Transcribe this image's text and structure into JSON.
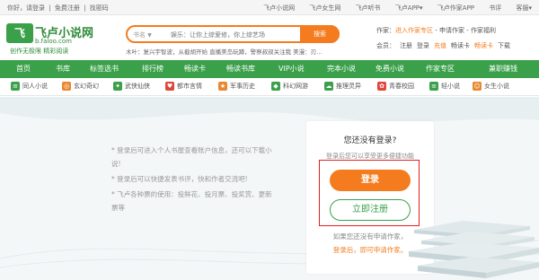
{
  "topbar": {
    "greeting": "你好，请登录",
    "free_register": "免费注册",
    "find_password": "找密码",
    "sep": "|",
    "links": [
      "飞卢小说网",
      "飞卢女生网",
      "飞卢听书",
      "飞卢APP▾",
      "飞卢作家APP",
      "书评",
      "客服▾"
    ]
  },
  "logo": {
    "mark": "飞",
    "name": "飞卢小说网",
    "domain": "b.faloo.com",
    "slogan": "创作无极限 精彩阅读"
  },
  "search": {
    "scope": "书名",
    "placeholder": "娱乐：让你上综爱修，你上综艺场",
    "button": "搜索",
    "hot_label": "木叶：",
    "hot_text": "复兴宇智波，从截胡开始  直播美岛玩蹲，警察叔叔关注我  美漫：刃..."
  },
  "author_area": {
    "label": "作家：",
    "enter": "进入作家专区",
    "sep": " - ",
    "apply": "申请作家",
    "sep2": " - ",
    "welfare": "作家福利"
  },
  "member_area": {
    "label": "会员：",
    "register": "注册",
    "login": "登录",
    "recharge": "充值",
    "coupon": "畅读卡",
    "vip_card": "畅读卡",
    "download": "下载"
  },
  "nav": [
    "首页",
    "书库",
    "标签选书",
    "排行榜",
    "畅读卡",
    "畅读书库",
    "VIP小说",
    "完本小说",
    "免费小说",
    "作家专区",
    "兼职赚钱"
  ],
  "categories": [
    {
      "label": "同人小说",
      "color": "#3aa04a"
    },
    {
      "label": "玄幻奇幻",
      "color": "#e8872f"
    },
    {
      "label": "武侠仙侠",
      "color": "#3aa04a"
    },
    {
      "label": "都市言情",
      "color": "#e0463a"
    },
    {
      "label": "军事历史",
      "color": "#e8872f"
    },
    {
      "label": "科幻网游",
      "color": "#3aa04a"
    },
    {
      "label": "推理灵异",
      "color": "#3aa04a"
    },
    {
      "label": "青春校园",
      "color": "#e0463a"
    },
    {
      "label": "轻小说",
      "color": "#3aa04a"
    },
    {
      "label": "女生小说",
      "color": "#e8872f"
    }
  ],
  "tips": [
    "* 登录后可进入个人书屋查看账户信息，还可以下载小说!",
    "* 登录后可以快捷发表书评，快和作者交流吧!",
    "* 飞卢各种票的使用：投鲜花、投月票、投奖赏、更新票等"
  ],
  "card": {
    "title": "您还没有登录?",
    "subtitle": "登录后您可以享受更多便捷功能",
    "login_button": "登录",
    "register_button": "立即注册",
    "hint": "如果您还没有申请作家，",
    "hint_link": "登录后，即可申请作家。"
  },
  "colors": {
    "green": "#3aa04a",
    "orange": "#f47c1f",
    "highlight": "#e02020"
  }
}
